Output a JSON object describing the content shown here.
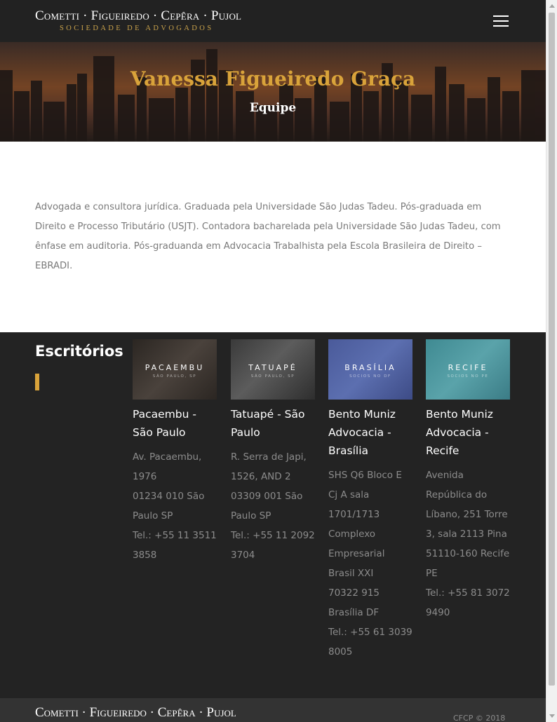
{
  "navbar": {
    "brand_name": "Cometti · Figueiredo · Cepêra · Pujol",
    "brand_sub": "SOCIEDADE DE ADVOGADOS",
    "menu_icon": "hamburger-menu-icon"
  },
  "hero": {
    "title": "Vanessa Figueiredo Graça",
    "subtitle": "Equipe"
  },
  "bio": {
    "text": "Advogada e consultora jurídica. Graduada pela Universidade São Judas Tadeu. Pós-graduada em Direito e Processo Tributário (USJT). Contadora bacharelada pela Universidade São Judas Tadeu, com ênfase em auditoria. Pós-graduanda em Advocacia Trabalhista pela Escola Brasileira de Direito – EBRADI."
  },
  "offices": {
    "title": "Escritórios",
    "accent_color": "#d9a33a",
    "items": [
      {
        "image_label": "PACAEMBU",
        "image_sublabel": "SÃO PAULO, SP",
        "name": "Pacaembu - São Paulo",
        "address_lines": [
          "Av. Pacaembu, 1976",
          "01234 010 São Paulo SP",
          "Tel.: +55 11 3511 3858"
        ]
      },
      {
        "image_label": "TATUAPÉ",
        "image_sublabel": "SÃO PAULO, SP",
        "name": "Tatuapé - São Paulo",
        "address_lines": [
          "R. Serra de Japi, 1526, AND 2",
          "03309 001 São Paulo SP",
          "Tel.: +55 11 2092 3704"
        ]
      },
      {
        "image_label": "BRASÍLIA",
        "image_sublabel": "SOCIOS NO DF",
        "name": "Bento Muniz Advocacia - Brasília",
        "address_lines": [
          "SHS Q6 Bloco E Cj A sala 1701/1713 Complexo Empresarial Brasil XXI",
          "70322 915 Brasília DF",
          "Tel.: +55 61 3039 8005"
        ]
      },
      {
        "image_label": "RECIFE",
        "image_sublabel": "SOCIOS NO PE",
        "name": "Bento Muniz Advocacia - Recife",
        "address_lines": [
          "Avenida República do Líbano, 251 Torre 3, sala 2113 Pina",
          "51110-160 Recife PE",
          "Tel.: +55 81 3072 9490"
        ]
      }
    ]
  },
  "footer": {
    "brand_name": "Cometti · Figueiredo · Cepêra · Pujol",
    "copyright": "CFCP © 2018"
  }
}
